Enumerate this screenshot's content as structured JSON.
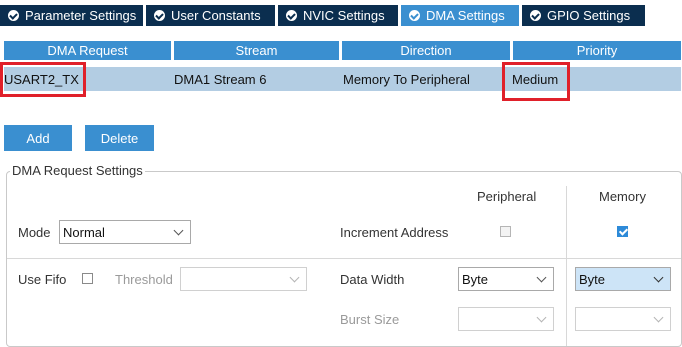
{
  "tabs": [
    {
      "label": "Parameter Settings",
      "active": false
    },
    {
      "label": "User Constants",
      "active": false
    },
    {
      "label": "NVIC Settings",
      "active": false
    },
    {
      "label": "DMA Settings",
      "active": true
    },
    {
      "label": "GPIO Settings",
      "active": false
    }
  ],
  "table": {
    "headers": [
      "DMA Request",
      "Stream",
      "Direction",
      "Priority"
    ],
    "rows": [
      {
        "request": "USART2_TX",
        "stream": "DMA1 Stream 6",
        "direction": "Memory To Peripheral",
        "priority": "Medium"
      }
    ]
  },
  "buttons": {
    "add": "Add",
    "delete": "Delete"
  },
  "settings": {
    "title": "DMA Request Settings",
    "peripheral_header": "Peripheral",
    "memory_header": "Memory",
    "mode_label": "Mode",
    "mode_value": "Normal",
    "increment_label": "Increment Address",
    "peripheral_increment": false,
    "memory_increment": true,
    "use_fifo_label": "Use Fifo",
    "use_fifo": false,
    "threshold_label": "Threshold",
    "threshold_value": "",
    "data_width_label": "Data Width",
    "peripheral_data_width": "Byte",
    "memory_data_width": "Byte",
    "burst_size_label": "Burst Size",
    "peripheral_burst": "",
    "memory_burst": ""
  },
  "colors": {
    "tab_bg": "#0b2e4f",
    "tab_active": "#3a8fd0",
    "row_selected": "#b3cde3",
    "highlight_box": "#e0202a"
  }
}
